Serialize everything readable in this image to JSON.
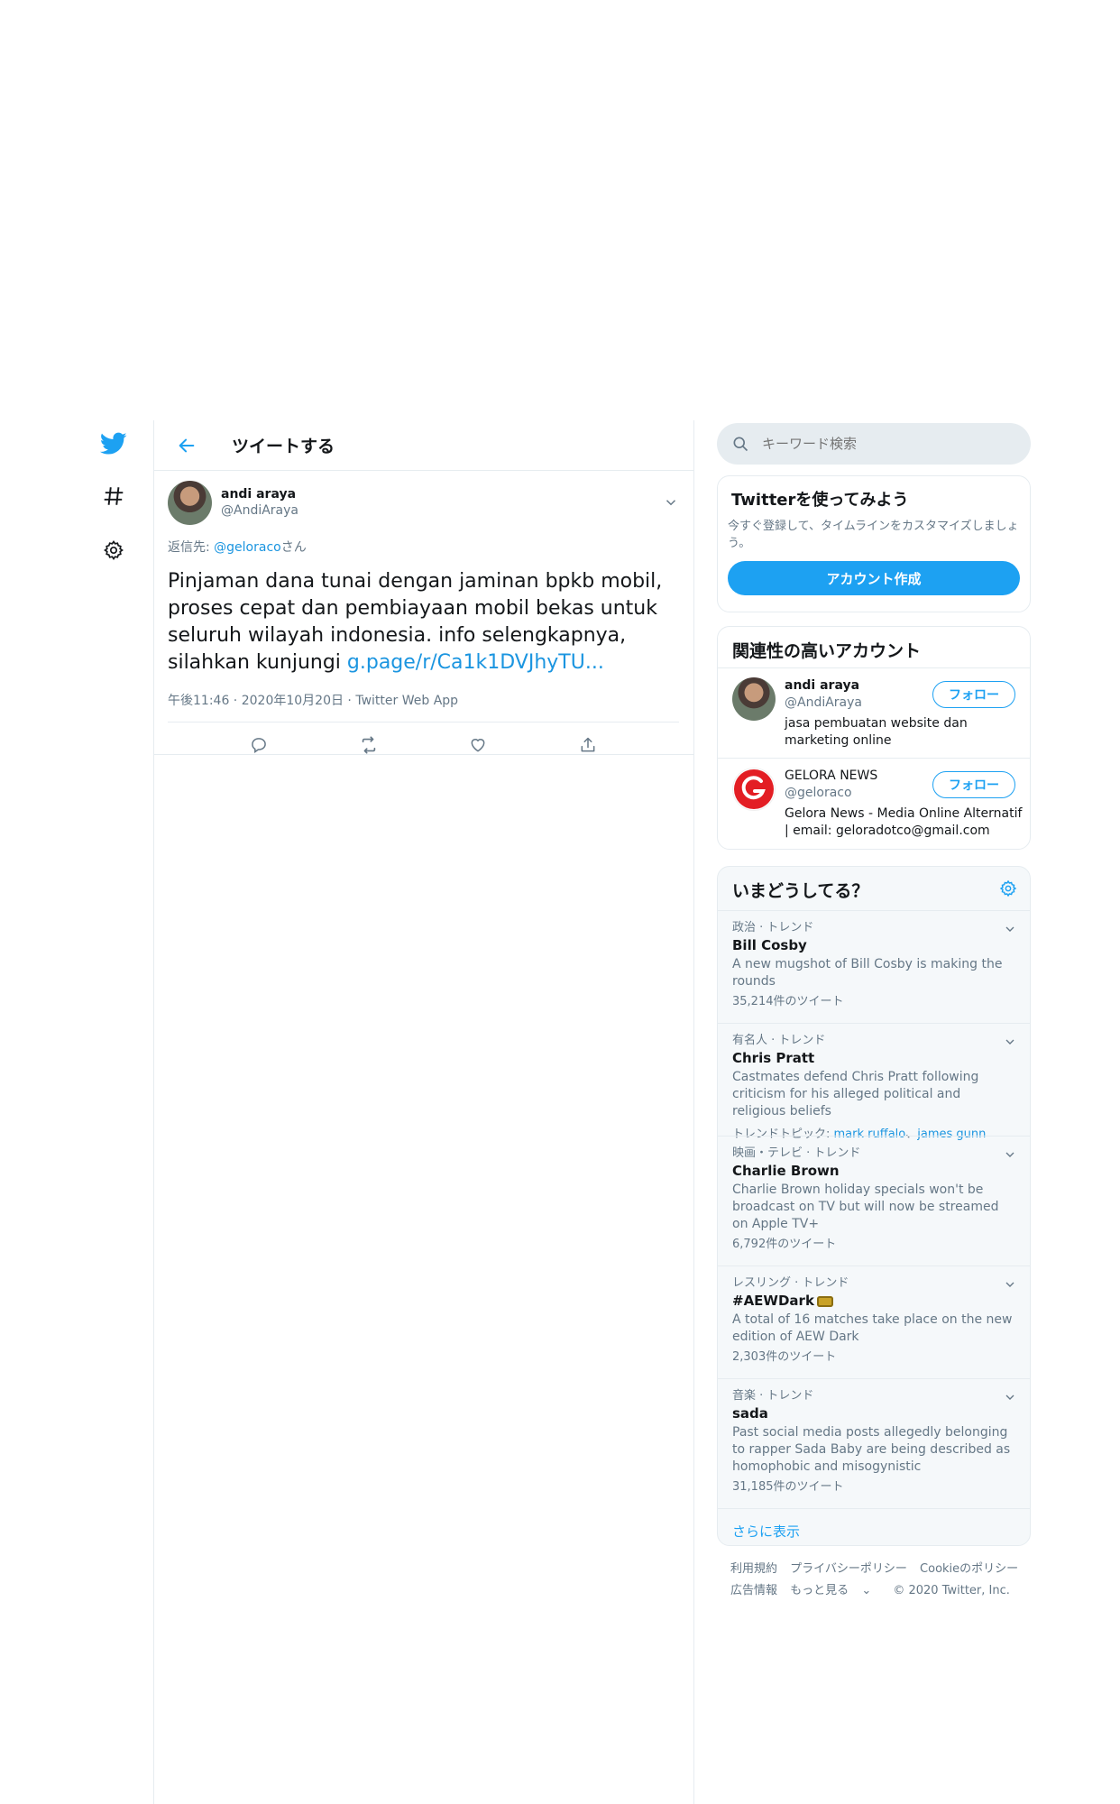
{
  "header": {
    "title": "ツイートする"
  },
  "tweet": {
    "author_name": "andi araya",
    "author_handle": "@AndiAraya",
    "reply_prefix": "返信先: ",
    "reply_handle": "@geloraco",
    "reply_suffix": "さん",
    "text": "Pinjaman dana tunai dengan jaminan bpkb mobil, proses cepat dan pembiayaan mobil bekas untuk seluruh wilayah indonesia. info selengkapnya, silahkan kunjungi ",
    "link": "g.page/r/Ca1k1DVJhyTU...",
    "time": "午後11:46",
    "date": "2020年10月20日",
    "source": "Twitter Web App"
  },
  "search": {
    "placeholder": "キーワード検索"
  },
  "signup": {
    "title": "Twitterを使ってみよう",
    "description": "今すぐ登録して、タイムラインをカスタマイズしましょう。",
    "button": "アカウント作成"
  },
  "related": {
    "title": "関連性の高いアカウント",
    "accounts": [
      {
        "name": "andi araya",
        "handle": "@AndiAraya",
        "bio": "jasa pembuatan website dan marketing online",
        "follow": "フォロー"
      },
      {
        "name": "GELORA NEWS",
        "handle": "@geloraco",
        "bio": "Gelora News - Media Online Alternatif | email: geloradotco@gmail.com",
        "follow": "フォロー"
      }
    ]
  },
  "trends": {
    "title": "いまどうしてる？",
    "items": [
      {
        "category": "政治 · トレンド",
        "name": "Bill Cosby",
        "desc": "A new mugshot of Bill Cosby is making the rounds",
        "count": "35,214件のツイート"
      },
      {
        "category": "有名人 · トレンド",
        "name": "Chris Pratt",
        "desc": "Castmates defend Chris Pratt following criticism for his alleged political and religious beliefs",
        "topics_label": "トレンドトピック: ",
        "topic1": "mark ruffalo",
        "topic_sep": "、",
        "topic2": "james gunn"
      },
      {
        "category": "映画・テレビ · トレンド",
        "name": "Charlie Brown",
        "desc": "Charlie Brown holiday specials won't be broadcast on TV but will now be streamed on Apple TV+",
        "count": "6,792件のツイート"
      },
      {
        "category": "レスリング · トレンド",
        "name": "#AEWDark",
        "desc": "A total of 16 matches take place on the new edition of AEW Dark",
        "count": "2,303件のツイート"
      },
      {
        "category": "音楽 · トレンド",
        "name": "sada",
        "desc": "Past social media posts allegedly belonging to rapper Sada Baby are being described as homophobic and misogynistic",
        "count": "31,185件のツイート"
      }
    ],
    "show_more": "さらに表示"
  },
  "footer": {
    "terms": "利用規約",
    "privacy": "プライバシーポリシー",
    "cookies": "Cookieのポリシー",
    "ads": "広告情報",
    "more": "もっと見る",
    "copyright": "© 2020 Twitter, Inc."
  },
  "colors": {
    "accent": "#1da1f2",
    "link": "#1b95e0",
    "secondary_text": "#657786",
    "border": "#e6ecf0"
  }
}
